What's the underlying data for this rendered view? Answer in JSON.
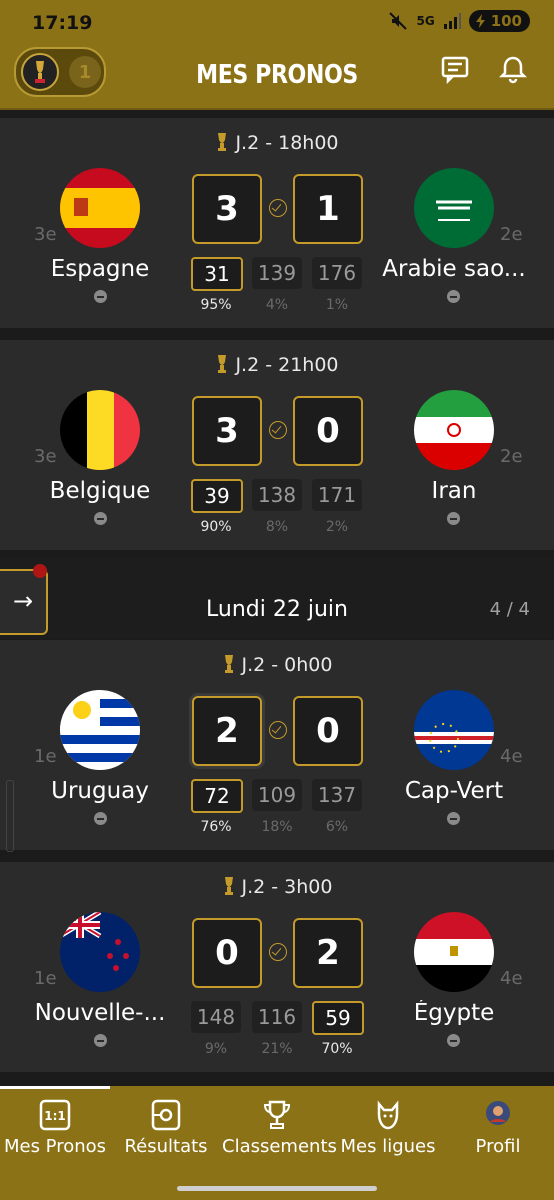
{
  "status_bar": {
    "time": "17:19",
    "network": "5G",
    "battery": "100"
  },
  "header": {
    "title": "MES PRONOS",
    "toggle_number": "1"
  },
  "matches": [
    {
      "round": "J.2",
      "time": "18h00",
      "home": {
        "name": "Espagne",
        "rank": "3e"
      },
      "away": {
        "name": "Arabie sao...",
        "rank": "2e"
      },
      "score_home": "3",
      "score_away": "1",
      "stats": [
        "31",
        "139",
        "176"
      ],
      "pcts": [
        "95%",
        "4%",
        "1%"
      ],
      "pick": 0
    },
    {
      "round": "J.2",
      "time": "21h00",
      "home": {
        "name": "Belgique",
        "rank": "3e"
      },
      "away": {
        "name": "Iran",
        "rank": "2e"
      },
      "score_home": "3",
      "score_away": "0",
      "stats": [
        "39",
        "138",
        "171"
      ],
      "pcts": [
        "90%",
        "8%",
        "2%"
      ],
      "pick": 0
    },
    {
      "round": "J.2",
      "time": "0h00",
      "home": {
        "name": "Uruguay",
        "rank": "1e"
      },
      "away": {
        "name": "Cap-Vert",
        "rank": "4e"
      },
      "score_home": "2",
      "score_away": "0",
      "stats": [
        "72",
        "109",
        "137"
      ],
      "pcts": [
        "76%",
        "18%",
        "6%"
      ],
      "pick": 0
    },
    {
      "round": "J.2",
      "time": "3h00",
      "home": {
        "name": "Nouvelle-...",
        "rank": "1e"
      },
      "away": {
        "name": "Égypte",
        "rank": "4e"
      },
      "score_home": "0",
      "score_away": "2",
      "stats": [
        "148",
        "116",
        "59"
      ],
      "pcts": [
        "9%",
        "21%",
        "70%"
      ],
      "pick": 2
    }
  ],
  "day_separator": {
    "title": "Lundi 22 juin",
    "count": "4 / 4"
  },
  "nav": [
    {
      "label": "Mes Pronos",
      "icon": "prono-icon"
    },
    {
      "label": "Résultats",
      "icon": "results-icon"
    },
    {
      "label": "Classements",
      "icon": "trophy-icon"
    },
    {
      "label": "Mes ligues",
      "icon": "league-icon"
    },
    {
      "label": "Profil",
      "icon": "avatar-icon"
    }
  ],
  "colors": {
    "gold": "#8c7217",
    "accent": "#c49a2a",
    "card": "#2b2b2b"
  }
}
